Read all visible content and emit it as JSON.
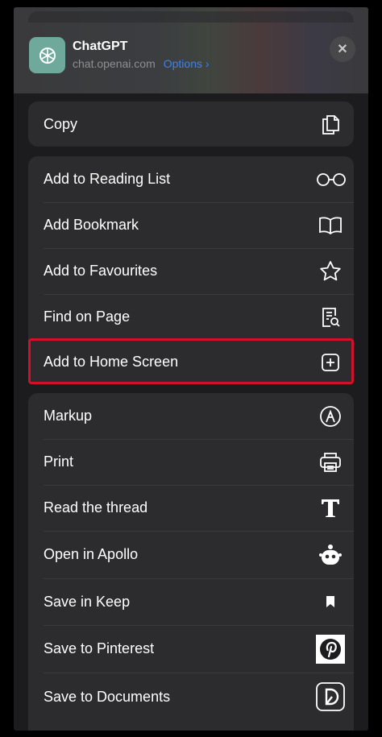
{
  "header": {
    "app_name": "ChatGPT",
    "url": "chat.openai.com",
    "options_label": "Options ›",
    "close_glyph": "✕"
  },
  "copy": {
    "label": "Copy",
    "icon": "copy-icon"
  },
  "group1": [
    {
      "label": "Add to Reading List",
      "icon": "glasses-icon"
    },
    {
      "label": "Add Bookmark",
      "icon": "book-icon"
    },
    {
      "label": "Add to Favourites",
      "icon": "star-icon"
    },
    {
      "label": "Find on Page",
      "icon": "find-page-icon"
    }
  ],
  "add_home": {
    "label": "Add to Home Screen",
    "icon": "plus-square-icon",
    "highlight_color": "#d0112b"
  },
  "group2": [
    {
      "label": "Markup",
      "icon": "markup-icon"
    },
    {
      "label": "Print",
      "icon": "printer-icon"
    },
    {
      "label": "Read the thread",
      "icon": "t-icon"
    },
    {
      "label": "Open in Apollo",
      "icon": "apollo-icon"
    },
    {
      "label": "Save in Keep",
      "icon": "bookmark-icon"
    },
    {
      "label": "Save to Pinterest",
      "icon": "pinterest-icon"
    },
    {
      "label": "Save to Documents",
      "icon": "documents-icon"
    }
  ]
}
